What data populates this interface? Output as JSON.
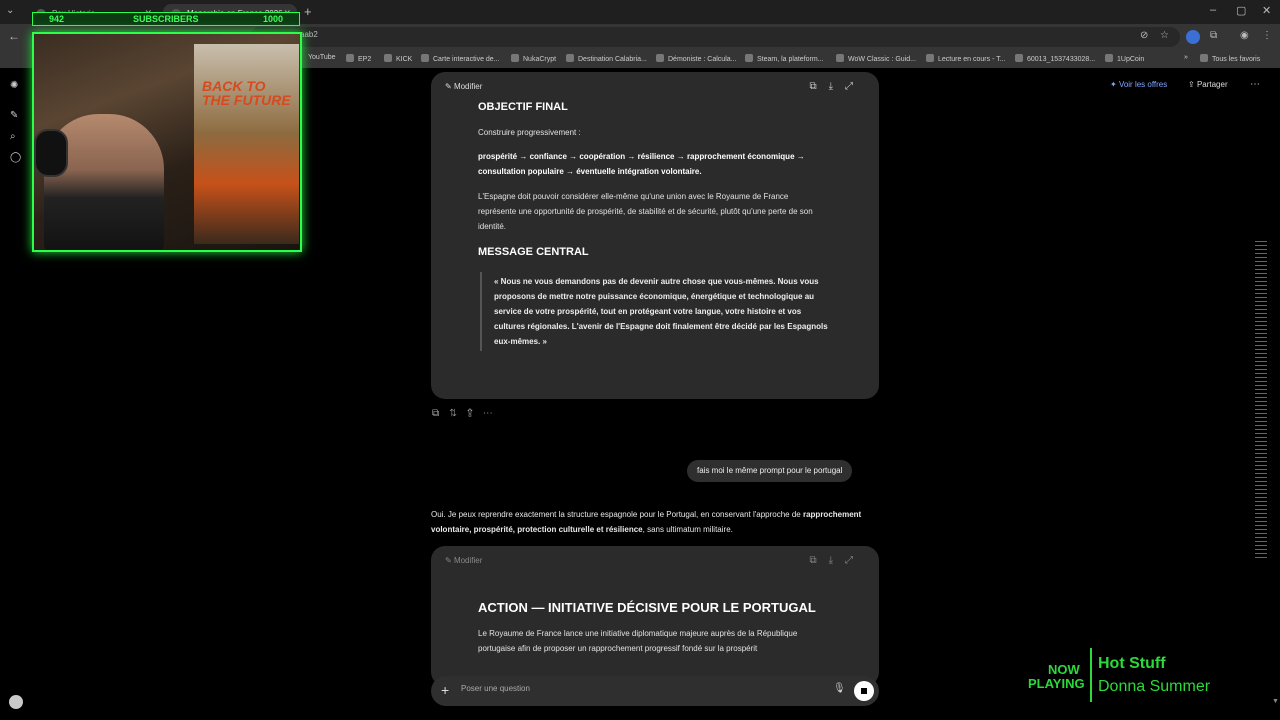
{
  "browser": {
    "tabs": [
      {
        "label": "Pax Historia"
      },
      {
        "label": "Monarchie en France 2026"
      }
    ],
    "url_fragment": "aab2",
    "bookmarks": [
      "YouTube",
      "EP2",
      "KICK",
      "Carte interactive de...",
      "NukaCrypt",
      "Destination Calabria...",
      "Démoniste : Calcula...",
      "Steam, la plateform...",
      "WoW Classic : Guid...",
      "Lecture en cours - T...",
      "60013_1537433028...",
      "1UpCoin",
      "Tous les favoris"
    ]
  },
  "overlay": {
    "subscriber_current": "942",
    "subscriber_label": "SUBSCRIBERS",
    "subscriber_goal": "1000",
    "poster_title": "BACK TO THE FUTURE",
    "now_playing_1": "NOW",
    "now_playing_2": "PLAYING",
    "song_title": "Hot Stuff",
    "song_artist": "Donna Summer"
  },
  "header": {
    "offers_label": "Voir les offres",
    "share_label": "Partager"
  },
  "canvas1": {
    "modify_label": "Modifier",
    "objective_title": "OBJECTIF FINAL",
    "objective_intro": "Construire progressivement :",
    "objective_chain": "prospérité → confiance → coopération → résilience → rapprochement économique → consultation populaire → éventuelle intégration volontaire.",
    "objective_text": "L'Espagne doit pouvoir considérer elle-même qu'une union avec le Royaume de France représente une opportunité de prospérité, de stabilité et de sécurité, plutôt qu'une perte de son identité.",
    "message_title": "MESSAGE CENTRAL",
    "message_quote": "« Nous ne vous demandons pas de devenir autre chose que vous-mêmes. Nous vous proposons de mettre notre puissance économique, énergétique et technologique au service de votre prospérité, tout en protégeant votre langue, votre histoire et vos cultures régionales. L'avenir de l'Espagne doit finalement être décidé par les Espagnols eux-mêmes. »"
  },
  "user_message": "fais moi le même prompt pour le portugal",
  "assistant_reply": {
    "part1": "Oui. Je peux reprendre exactement la structure espagnole pour le Portugal, en conservant l'approche de ",
    "bold": "rapprochement volontaire, prospérité, protection culturelle et résilience",
    "part2": ", sans ultimatum militaire."
  },
  "canvas2": {
    "modify_label": "Modifier",
    "title": "ACTION — INITIATIVE DÉCISIVE POUR LE PORTUGAL",
    "text": "Le Royaume de France lance une initiative diplomatique majeure auprès de la République portugaise afin de proposer un rapprochement progressif fondé sur la prospérit"
  },
  "composer": {
    "placeholder": "Poser une question"
  }
}
